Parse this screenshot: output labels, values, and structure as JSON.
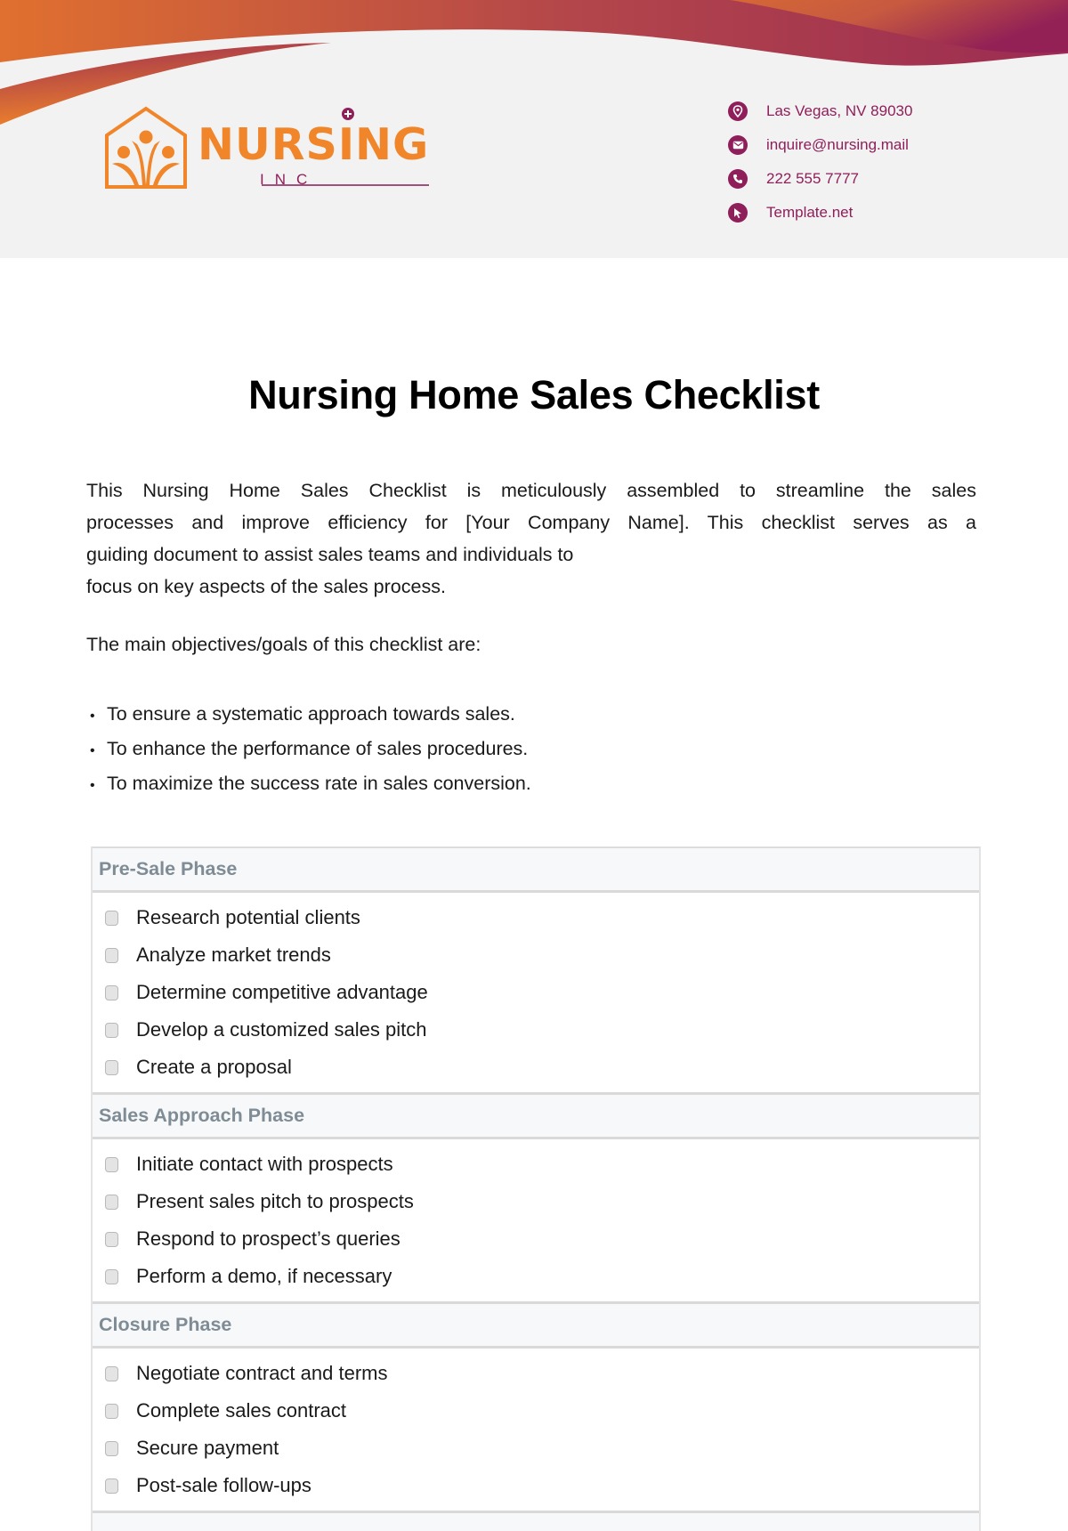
{
  "brand": {
    "name": "NURSING",
    "sub": "INC",
    "colors": {
      "orange": "#f0852a",
      "plum": "#8e1f5a"
    }
  },
  "contacts": [
    {
      "icon": "location-pin-icon",
      "text": "Las Vegas, NV 89030"
    },
    {
      "icon": "mail-icon",
      "text": "inquire@nursing.mail"
    },
    {
      "icon": "phone-icon",
      "text": "222 555 7777"
    },
    {
      "icon": "cursor-pointer-icon",
      "text": "Template.net"
    }
  ],
  "title": "Nursing Home Sales Checklist",
  "intro": {
    "lines": [
      "This Nursing Home Sales Checklist is meticulously assembled to streamline the sales",
      "processes and improve efficiency for [Your Company Name]. This checklist serves as a",
      "guiding document to assist sales teams and individuals to",
      "focus on key aspects of the sales process."
    ],
    "objectives_label": "The main objectives/goals of this checklist are:",
    "goals": [
      "To ensure a systematic approach towards sales.",
      "To enhance the performance of sales procedures.",
      "To maximize the success rate in sales conversion."
    ]
  },
  "checklist": {
    "phases": [
      {
        "title": "Pre-Sale Phase",
        "items": [
          {
            "label": "Research potential clients",
            "checked": false
          },
          {
            "label": "Analyze market trends",
            "checked": false
          },
          {
            "label": "Determine competitive advantage",
            "checked": false
          },
          {
            "label": "Develop a customized sales pitch",
            "checked": false
          },
          {
            "label": "Create a proposal",
            "checked": false
          }
        ]
      },
      {
        "title": "Sales Approach Phase",
        "items": [
          {
            "label": "Initiate contact with prospects",
            "checked": false
          },
          {
            "label": "Present sales pitch to prospects",
            "checked": false
          },
          {
            "label": "Respond to prospect’s queries",
            "checked": false
          },
          {
            "label": "Perform a demo, if necessary",
            "checked": false
          }
        ]
      },
      {
        "title": "Closure Phase",
        "items": [
          {
            "label": "Negotiate contract and terms",
            "checked": false
          },
          {
            "label": "Complete sales contract",
            "checked": false
          },
          {
            "label": "Secure payment",
            "checked": false
          },
          {
            "label": "Post-sale follow-ups",
            "checked": false
          }
        ]
      }
    ]
  }
}
